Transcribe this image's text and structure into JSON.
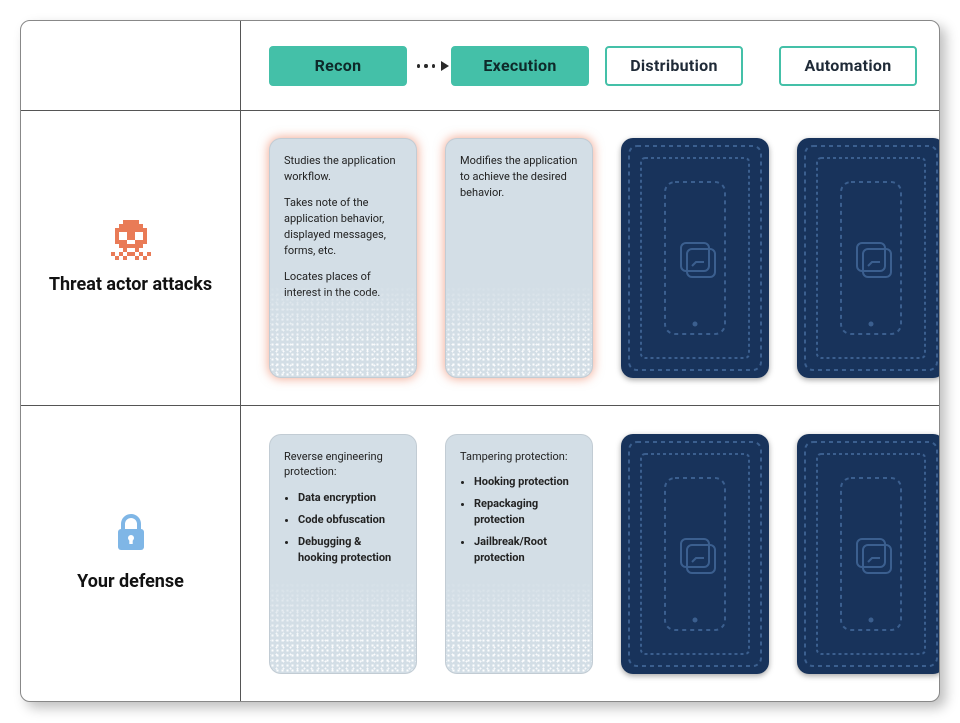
{
  "tabs": {
    "recon": "Recon",
    "execution": "Execution",
    "distribution": "Distribution",
    "automation": "Automation"
  },
  "rows": {
    "attacks_label": "Threat actor attacks",
    "defense_label": "Your defense"
  },
  "attacks": {
    "recon": {
      "p1": "Studies the application workflow.",
      "p2": "Takes note of the application behavior, displayed messages, forms, etc.",
      "p3": "Locates places of interest in the code."
    },
    "execution": {
      "p1": "Modifies the application to achieve the desired behavior."
    }
  },
  "defense": {
    "recon": {
      "title": "Reverse engineering protection:",
      "items": [
        "Data encryption",
        "Code obfuscation",
        "Debugging & hooking protection"
      ]
    },
    "execution": {
      "title": "Tampering protection:",
      "items": [
        "Hooking protection",
        "Repackaging protection",
        "Jailbreak/Root protection"
      ]
    }
  },
  "colors": {
    "accent": "#44c0a8",
    "card_back": "#18335b",
    "card_open": "#d3dee6",
    "skull": "#e97b57",
    "lock": "#7fb6e6"
  }
}
